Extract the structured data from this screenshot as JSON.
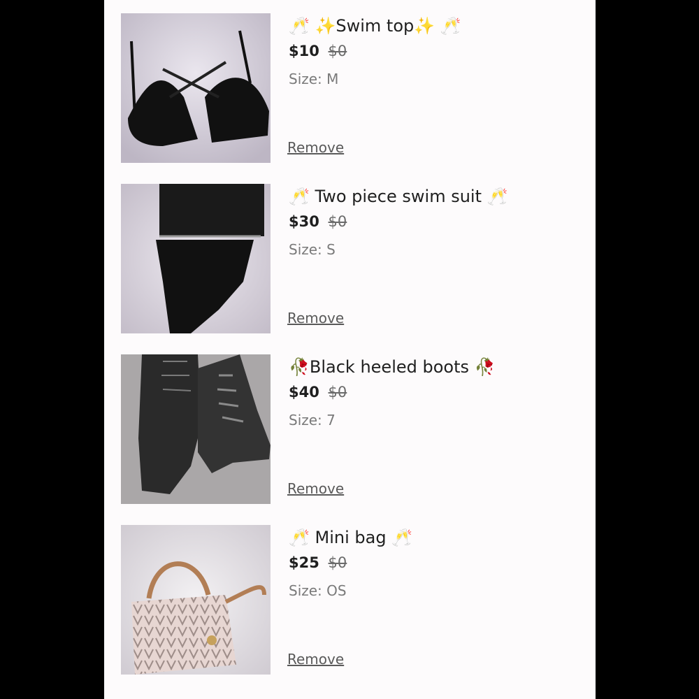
{
  "items": [
    {
      "title": "🥂 ✨Swim top✨ 🥂",
      "price": "$10",
      "old_price": "$0",
      "size": "Size: M",
      "remove": "Remove"
    },
    {
      "title": "🥂 Two piece swim suit 🥂",
      "price": "$30",
      "old_price": "$0",
      "size": "Size: S",
      "remove": "Remove"
    },
    {
      "title": "🥀Black heeled boots 🥀",
      "price": "$40",
      "old_price": "$0",
      "size": "Size: 7",
      "remove": "Remove"
    },
    {
      "title": "🥂 Mini bag 🥂",
      "price": "$25",
      "old_price": "$0",
      "size": "Size: OS",
      "remove": "Remove"
    }
  ]
}
